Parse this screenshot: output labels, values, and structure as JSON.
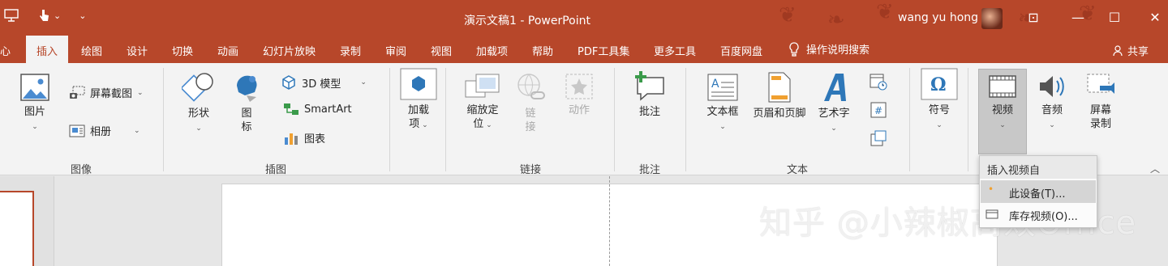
{
  "titlebar": {
    "doc_title": "演示文稿1  -  PowerPoint",
    "user": "wang yu hong",
    "qat_dropdown": "⌄",
    "qat_more": "⌄",
    "display_options": "⊡",
    "minimize": "—",
    "maximize": "☐",
    "close": "✕"
  },
  "tabs": {
    "items": [
      "心",
      "插入",
      "绘图",
      "设计",
      "切换",
      "动画",
      "幻灯片放映",
      "录制",
      "审阅",
      "视图",
      "加载项",
      "帮助",
      "PDF工具集",
      "更多工具",
      "百度网盘",
      "操作说明搜索"
    ],
    "active": "插入",
    "share": "共享"
  },
  "ribbon": {
    "images_group": {
      "label": "图像",
      "picture": "图片",
      "screenshot": "屏幕截图",
      "album": "相册"
    },
    "illustrations_group": {
      "label": "插图",
      "shapes": "形状",
      "icons_1": "图",
      "icons_2": "标",
      "model3d": "3D 模型",
      "smartart": "SmartArt",
      "chart": "图表"
    },
    "addins_group": {
      "addins_1": "加载",
      "addins_2": "项"
    },
    "links_group": {
      "label": "链接",
      "zoom_1": "缩放定",
      "zoom_2": "位",
      "link_1": "链",
      "link_2": "接",
      "action": "动作"
    },
    "comments_group": {
      "label": "批注",
      "comment": "批注"
    },
    "text_group": {
      "label": "文本",
      "textbox": "文本框",
      "header_footer": "页眉和页脚",
      "wordart": "艺术字"
    },
    "symbols_group": {
      "symbol": "符号"
    },
    "media_group": {
      "video": "视频",
      "audio": "音频",
      "screen_rec_1": "屏幕",
      "screen_rec_2": "录制"
    }
  },
  "dropdown": {
    "header": "插入视频自",
    "items": [
      "此设备(T)...",
      "库存视频(O)..."
    ]
  },
  "watermark": "知乎 @小辣椒高效Office",
  "colors": {
    "accent": "#b7472a",
    "ribbon_bg": "#f3f3f3"
  }
}
